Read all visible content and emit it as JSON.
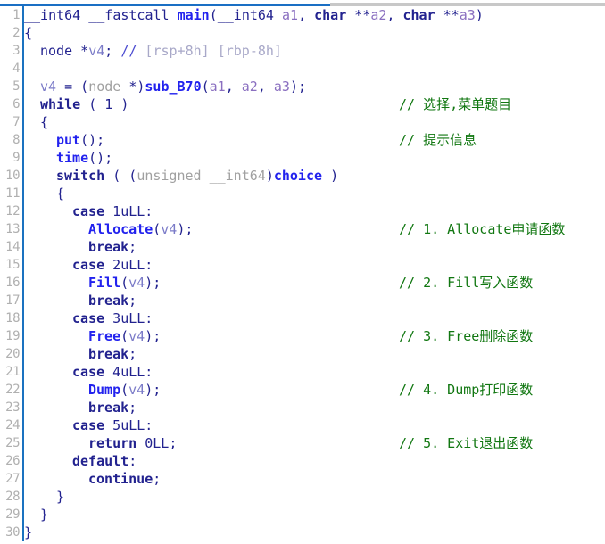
{
  "window": {
    "kind": "decompiler-pseudocode-view",
    "tabstrip": {
      "active_tab_color": "#1a6fc4",
      "inactive_tab_color": "#c8c8c8"
    }
  },
  "theme": {
    "background": "#ffffff",
    "gutter_text": "#b0b0b0",
    "gutter_rule": "#1a72c0",
    "default_text": "#22228f",
    "keyword": "#22228f",
    "function_name": "#2222ee",
    "variable": "#7b7bc8",
    "argument": "#8a6fc0",
    "dim_type": "#a0a0a0",
    "comment": "#117711",
    "inline_comment_dim": "#a8a8c8"
  },
  "code": {
    "language": "C pseudocode",
    "line_count": 30,
    "lines": [
      {
        "n": "1",
        "indent": 0,
        "text": "__int64 __fastcall main(__int64 a1, char **a2, char **a3)",
        "comment": ""
      },
      {
        "n": "2",
        "indent": 0,
        "text": "{",
        "comment": ""
      },
      {
        "n": "3",
        "indent": 1,
        "text": "node *v4; // [rsp+8h] [rbp-8h]",
        "comment": ""
      },
      {
        "n": "4",
        "indent": 0,
        "text": "",
        "comment": ""
      },
      {
        "n": "5",
        "indent": 1,
        "text": "v4 = (node *)sub_B70(a1, a2, a3);",
        "comment": ""
      },
      {
        "n": "6",
        "indent": 1,
        "text": "while ( 1 )",
        "comment": "// 选择,菜单题目"
      },
      {
        "n": "7",
        "indent": 1,
        "text": "{",
        "comment": ""
      },
      {
        "n": "8",
        "indent": 2,
        "text": "put();",
        "comment": "// 提示信息"
      },
      {
        "n": "9",
        "indent": 2,
        "text": "time();",
        "comment": ""
      },
      {
        "n": "10",
        "indent": 2,
        "text": "switch ( (unsigned __int64)choice )",
        "comment": ""
      },
      {
        "n": "11",
        "indent": 2,
        "text": "{",
        "comment": ""
      },
      {
        "n": "12",
        "indent": 3,
        "text": "case 1uLL:",
        "comment": ""
      },
      {
        "n": "13",
        "indent": 4,
        "text": "Allocate(v4);",
        "comment": "// 1. Allocate申请函数"
      },
      {
        "n": "14",
        "indent": 4,
        "text": "break;",
        "comment": ""
      },
      {
        "n": "15",
        "indent": 3,
        "text": "case 2uLL:",
        "comment": ""
      },
      {
        "n": "16",
        "indent": 4,
        "text": "Fill(v4);",
        "comment": "// 2. Fill写入函数"
      },
      {
        "n": "17",
        "indent": 4,
        "text": "break;",
        "comment": ""
      },
      {
        "n": "18",
        "indent": 3,
        "text": "case 3uLL:",
        "comment": ""
      },
      {
        "n": "19",
        "indent": 4,
        "text": "Free(v4);",
        "comment": "// 3. Free删除函数"
      },
      {
        "n": "20",
        "indent": 4,
        "text": "break;",
        "comment": ""
      },
      {
        "n": "21",
        "indent": 3,
        "text": "case 4uLL:",
        "comment": ""
      },
      {
        "n": "22",
        "indent": 4,
        "text": "Dump(v4);",
        "comment": "// 4. Dump打印函数"
      },
      {
        "n": "23",
        "indent": 4,
        "text": "break;",
        "comment": ""
      },
      {
        "n": "24",
        "indent": 3,
        "text": "case 5uLL:",
        "comment": ""
      },
      {
        "n": "25",
        "indent": 4,
        "text": "return 0LL;",
        "comment": "// 5. Exit退出函数"
      },
      {
        "n": "26",
        "indent": 3,
        "text": "default:",
        "comment": ""
      },
      {
        "n": "27",
        "indent": 4,
        "text": "continue;",
        "comment": ""
      },
      {
        "n": "28",
        "indent": 2,
        "text": "}",
        "comment": ""
      },
      {
        "n": "29",
        "indent": 1,
        "text": "}",
        "comment": ""
      },
      {
        "n": "30",
        "indent": 0,
        "text": "}",
        "comment": ""
      }
    ],
    "comments": [
      "// 选择,菜单题目",
      "// 提示信息",
      "// 1. Allocate申请函数",
      "// 2. Fill写入函数",
      "// 3. Free删除函数",
      "// 4. Dump打印函数",
      "// 5. Exit退出函数"
    ]
  }
}
